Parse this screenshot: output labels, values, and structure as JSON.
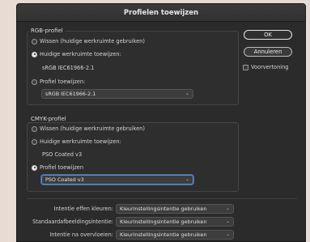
{
  "dialog": {
    "title": "Profielen toewijzen"
  },
  "rgb": {
    "legend": "RGB-profiel",
    "option_discard": "Wissen (huidige werkruimte gebruiken)",
    "option_working": "Huidige werkruimte toewijzen:",
    "working_profile": "sRGB IEC61966-2.1",
    "option_assign": "Profiel toewijzen:",
    "assign_select": "sRGB IEC61966-2.1",
    "selected": "working"
  },
  "cmyk": {
    "legend": "CMYK-profiel",
    "option_discard": "Wissen (huidige werkruimte gebruiken)",
    "option_working": "Huidige werkruimte toewijzen:",
    "working_profile": "PSO Coated v3",
    "option_assign": "Profiel toewijzen",
    "assign_select": "PSO Coated v3",
    "selected": "assign"
  },
  "buttons": {
    "ok": "OK",
    "cancel": "Annuleren",
    "preview": "Voorvertoning"
  },
  "intents": [
    {
      "label": "Intentie effen kleuren:",
      "value": "Kleurinstellingsintentie gebruiken"
    },
    {
      "label": "Standaardafbeeldingsintentie:",
      "value": "Kleurinstellingsintentie gebruiken"
    },
    {
      "label": "Intentie na overvloeien:",
      "value": "Kleurinstellingsintentie gebruiken"
    }
  ]
}
